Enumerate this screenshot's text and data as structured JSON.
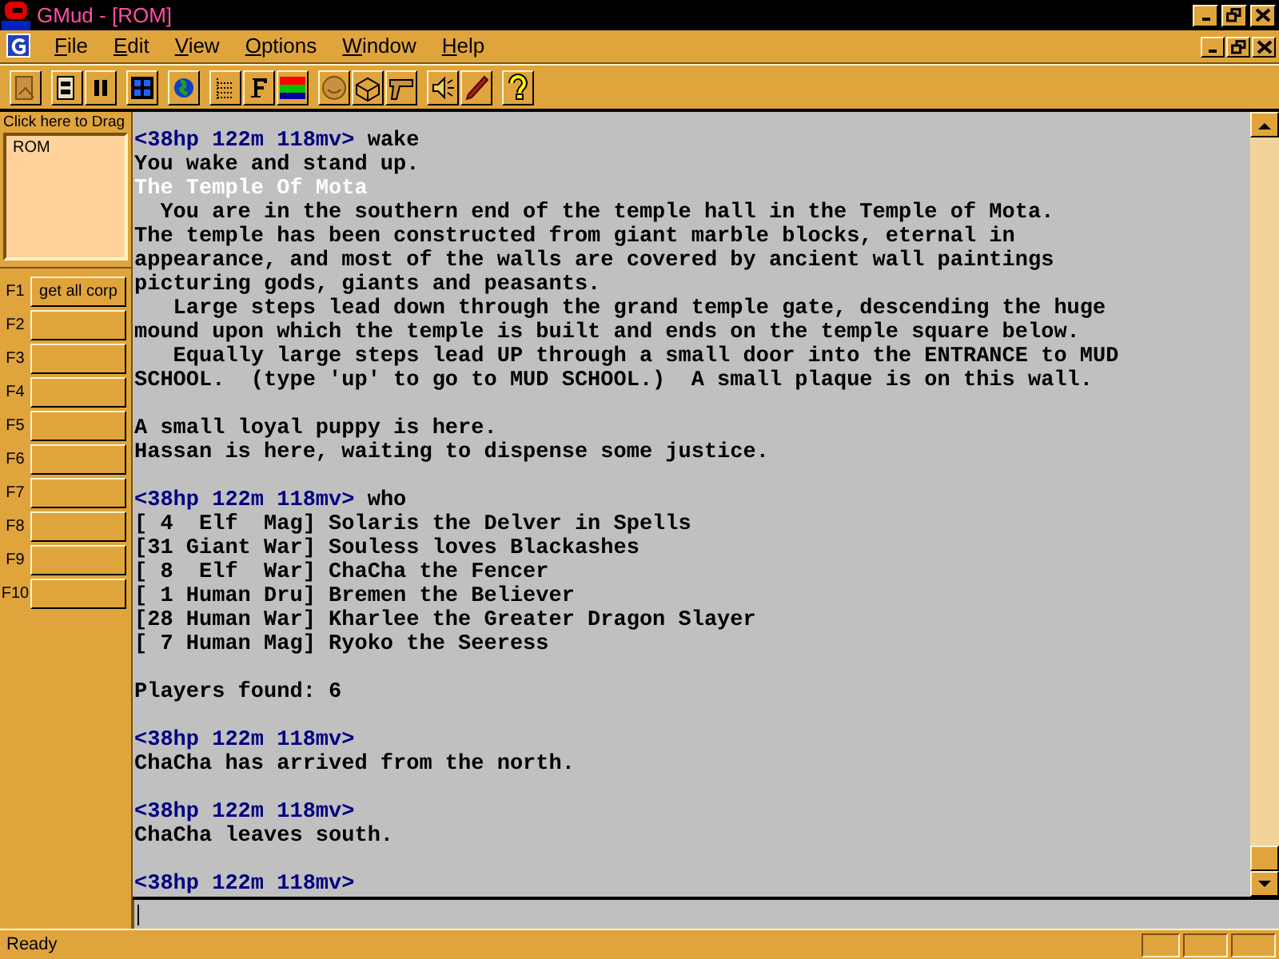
{
  "window": {
    "title": "GMud - [ROM]"
  },
  "menu": [
    "File",
    "Edit",
    "View",
    "Options",
    "Window",
    "Help"
  ],
  "session_panel": {
    "drag_label": "Click here to Drag",
    "sessions": [
      "ROM"
    ]
  },
  "macros": [
    {
      "key": "F1",
      "command": "get all corp"
    },
    {
      "key": "F2"
    },
    {
      "key": "F3"
    },
    {
      "key": "F4"
    },
    {
      "key": "F5"
    },
    {
      "key": "F6"
    },
    {
      "key": "F7"
    },
    {
      "key": "F8"
    },
    {
      "key": "F9"
    },
    {
      "key": "F10"
    }
  ],
  "terminal": [
    {
      "kind": "prompt",
      "prompt": "<38hp 122m 118mv>",
      "command": "wake"
    },
    {
      "kind": "text",
      "text": "You wake and stand up."
    },
    {
      "kind": "room",
      "text": "The Temple Of Mota"
    },
    {
      "kind": "text",
      "text": "  You are in the southern end of the temple hall in the Temple of Mota."
    },
    {
      "kind": "text",
      "text": "The temple has been constructed from giant marble blocks, eternal in"
    },
    {
      "kind": "text",
      "text": "appearance, and most of the walls are covered by ancient wall paintings"
    },
    {
      "kind": "text",
      "text": "picturing gods, giants and peasants."
    },
    {
      "kind": "text",
      "text": "   Large steps lead down through the grand temple gate, descending the huge"
    },
    {
      "kind": "text",
      "text": "mound upon which the temple is built and ends on the temple square below."
    },
    {
      "kind": "text",
      "text": "   Equally large steps lead UP through a small door into the ENTRANCE to MUD"
    },
    {
      "kind": "text",
      "text": "SCHOOL.  (type 'up' to go to MUD SCHOOL.)  A small plaque is on this wall."
    },
    {
      "kind": "blank"
    },
    {
      "kind": "text",
      "text": "A small loyal puppy is here."
    },
    {
      "kind": "text",
      "text": "Hassan is here, waiting to dispense some justice."
    },
    {
      "kind": "blank"
    },
    {
      "kind": "prompt",
      "prompt": "<38hp 122m 118mv>",
      "command": "who"
    },
    {
      "kind": "text",
      "text": "[ 4  Elf  Mag] Solaris the Delver in Spells"
    },
    {
      "kind": "text",
      "text": "[31 Giant War] Souless loves Blackashes"
    },
    {
      "kind": "text",
      "text": "[ 8  Elf  War] ChaCha the Fencer"
    },
    {
      "kind": "text",
      "text": "[ 1 Human Dru] Bremen the Believer"
    },
    {
      "kind": "text",
      "text": "[28 Human War] Kharlee the Greater Dragon Slayer"
    },
    {
      "kind": "text",
      "text": "[ 7 Human Mag] Ryoko the Seeress"
    },
    {
      "kind": "blank"
    },
    {
      "kind": "text",
      "text": "Players found: 6"
    },
    {
      "kind": "blank"
    },
    {
      "kind": "prompt",
      "prompt": "<38hp 122m 118mv>"
    },
    {
      "kind": "text",
      "text": "ChaCha has arrived from the north."
    },
    {
      "kind": "blank"
    },
    {
      "kind": "prompt",
      "prompt": "<38hp 122m 118mv>"
    },
    {
      "kind": "text",
      "text": "ChaCha leaves south."
    },
    {
      "kind": "blank"
    },
    {
      "kind": "prompt",
      "prompt": "<38hp 122m 118mv>"
    }
  ],
  "status_bar": {
    "text": "Ready"
  }
}
